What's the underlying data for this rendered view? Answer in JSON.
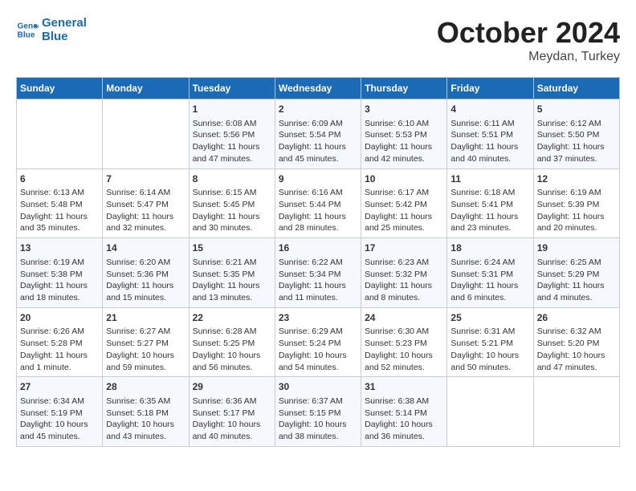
{
  "logo": {
    "line1": "General",
    "line2": "Blue"
  },
  "title": "October 2024",
  "subtitle": "Meydan, Turkey",
  "days_of_week": [
    "Sunday",
    "Monday",
    "Tuesday",
    "Wednesday",
    "Thursday",
    "Friday",
    "Saturday"
  ],
  "weeks": [
    [
      {
        "num": "",
        "sunrise": "",
        "sunset": "",
        "daylight": "",
        "empty": true
      },
      {
        "num": "",
        "sunrise": "",
        "sunset": "",
        "daylight": "",
        "empty": true
      },
      {
        "num": "1",
        "sunrise": "Sunrise: 6:08 AM",
        "sunset": "Sunset: 5:56 PM",
        "daylight": "Daylight: 11 hours and 47 minutes."
      },
      {
        "num": "2",
        "sunrise": "Sunrise: 6:09 AM",
        "sunset": "Sunset: 5:54 PM",
        "daylight": "Daylight: 11 hours and 45 minutes."
      },
      {
        "num": "3",
        "sunrise": "Sunrise: 6:10 AM",
        "sunset": "Sunset: 5:53 PM",
        "daylight": "Daylight: 11 hours and 42 minutes."
      },
      {
        "num": "4",
        "sunrise": "Sunrise: 6:11 AM",
        "sunset": "Sunset: 5:51 PM",
        "daylight": "Daylight: 11 hours and 40 minutes."
      },
      {
        "num": "5",
        "sunrise": "Sunrise: 6:12 AM",
        "sunset": "Sunset: 5:50 PM",
        "daylight": "Daylight: 11 hours and 37 minutes."
      }
    ],
    [
      {
        "num": "6",
        "sunrise": "Sunrise: 6:13 AM",
        "sunset": "Sunset: 5:48 PM",
        "daylight": "Daylight: 11 hours and 35 minutes."
      },
      {
        "num": "7",
        "sunrise": "Sunrise: 6:14 AM",
        "sunset": "Sunset: 5:47 PM",
        "daylight": "Daylight: 11 hours and 32 minutes."
      },
      {
        "num": "8",
        "sunrise": "Sunrise: 6:15 AM",
        "sunset": "Sunset: 5:45 PM",
        "daylight": "Daylight: 11 hours and 30 minutes."
      },
      {
        "num": "9",
        "sunrise": "Sunrise: 6:16 AM",
        "sunset": "Sunset: 5:44 PM",
        "daylight": "Daylight: 11 hours and 28 minutes."
      },
      {
        "num": "10",
        "sunrise": "Sunrise: 6:17 AM",
        "sunset": "Sunset: 5:42 PM",
        "daylight": "Daylight: 11 hours and 25 minutes."
      },
      {
        "num": "11",
        "sunrise": "Sunrise: 6:18 AM",
        "sunset": "Sunset: 5:41 PM",
        "daylight": "Daylight: 11 hours and 23 minutes."
      },
      {
        "num": "12",
        "sunrise": "Sunrise: 6:19 AM",
        "sunset": "Sunset: 5:39 PM",
        "daylight": "Daylight: 11 hours and 20 minutes."
      }
    ],
    [
      {
        "num": "13",
        "sunrise": "Sunrise: 6:19 AM",
        "sunset": "Sunset: 5:38 PM",
        "daylight": "Daylight: 11 hours and 18 minutes."
      },
      {
        "num": "14",
        "sunrise": "Sunrise: 6:20 AM",
        "sunset": "Sunset: 5:36 PM",
        "daylight": "Daylight: 11 hours and 15 minutes."
      },
      {
        "num": "15",
        "sunrise": "Sunrise: 6:21 AM",
        "sunset": "Sunset: 5:35 PM",
        "daylight": "Daylight: 11 hours and 13 minutes."
      },
      {
        "num": "16",
        "sunrise": "Sunrise: 6:22 AM",
        "sunset": "Sunset: 5:34 PM",
        "daylight": "Daylight: 11 hours and 11 minutes."
      },
      {
        "num": "17",
        "sunrise": "Sunrise: 6:23 AM",
        "sunset": "Sunset: 5:32 PM",
        "daylight": "Daylight: 11 hours and 8 minutes."
      },
      {
        "num": "18",
        "sunrise": "Sunrise: 6:24 AM",
        "sunset": "Sunset: 5:31 PM",
        "daylight": "Daylight: 11 hours and 6 minutes."
      },
      {
        "num": "19",
        "sunrise": "Sunrise: 6:25 AM",
        "sunset": "Sunset: 5:29 PM",
        "daylight": "Daylight: 11 hours and 4 minutes."
      }
    ],
    [
      {
        "num": "20",
        "sunrise": "Sunrise: 6:26 AM",
        "sunset": "Sunset: 5:28 PM",
        "daylight": "Daylight: 11 hours and 1 minute."
      },
      {
        "num": "21",
        "sunrise": "Sunrise: 6:27 AM",
        "sunset": "Sunset: 5:27 PM",
        "daylight": "Daylight: 10 hours and 59 minutes."
      },
      {
        "num": "22",
        "sunrise": "Sunrise: 6:28 AM",
        "sunset": "Sunset: 5:25 PM",
        "daylight": "Daylight: 10 hours and 56 minutes."
      },
      {
        "num": "23",
        "sunrise": "Sunrise: 6:29 AM",
        "sunset": "Sunset: 5:24 PM",
        "daylight": "Daylight: 10 hours and 54 minutes."
      },
      {
        "num": "24",
        "sunrise": "Sunrise: 6:30 AM",
        "sunset": "Sunset: 5:23 PM",
        "daylight": "Daylight: 10 hours and 52 minutes."
      },
      {
        "num": "25",
        "sunrise": "Sunrise: 6:31 AM",
        "sunset": "Sunset: 5:21 PM",
        "daylight": "Daylight: 10 hours and 50 minutes."
      },
      {
        "num": "26",
        "sunrise": "Sunrise: 6:32 AM",
        "sunset": "Sunset: 5:20 PM",
        "daylight": "Daylight: 10 hours and 47 minutes."
      }
    ],
    [
      {
        "num": "27",
        "sunrise": "Sunrise: 6:34 AM",
        "sunset": "Sunset: 5:19 PM",
        "daylight": "Daylight: 10 hours and 45 minutes."
      },
      {
        "num": "28",
        "sunrise": "Sunrise: 6:35 AM",
        "sunset": "Sunset: 5:18 PM",
        "daylight": "Daylight: 10 hours and 43 minutes."
      },
      {
        "num": "29",
        "sunrise": "Sunrise: 6:36 AM",
        "sunset": "Sunset: 5:17 PM",
        "daylight": "Daylight: 10 hours and 40 minutes."
      },
      {
        "num": "30",
        "sunrise": "Sunrise: 6:37 AM",
        "sunset": "Sunset: 5:15 PM",
        "daylight": "Daylight: 10 hours and 38 minutes."
      },
      {
        "num": "31",
        "sunrise": "Sunrise: 6:38 AM",
        "sunset": "Sunset: 5:14 PM",
        "daylight": "Daylight: 10 hours and 36 minutes."
      },
      {
        "num": "",
        "sunrise": "",
        "sunset": "",
        "daylight": "",
        "empty": true
      },
      {
        "num": "",
        "sunrise": "",
        "sunset": "",
        "daylight": "",
        "empty": true
      }
    ]
  ]
}
